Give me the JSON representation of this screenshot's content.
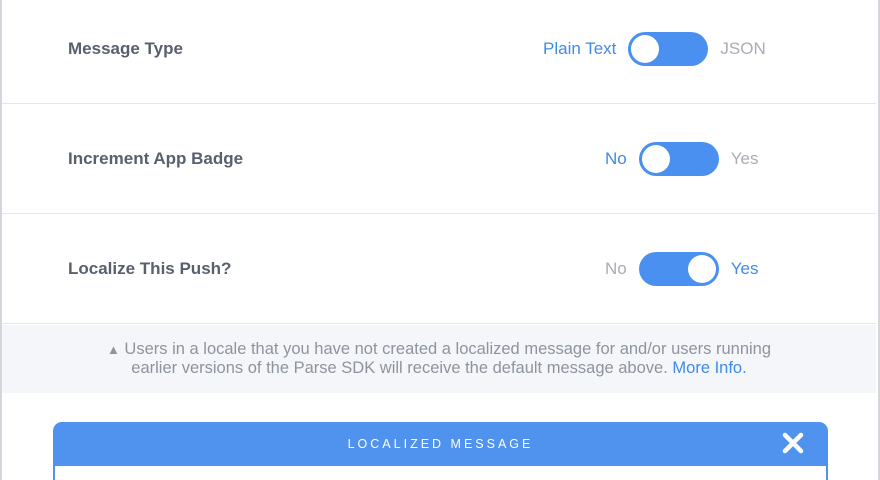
{
  "rows": [
    {
      "label": "Message Type",
      "left_option": "Plain Text",
      "right_option": "JSON",
      "selected": "Plain Text"
    },
    {
      "label": "Increment App Badge",
      "left_option": "No",
      "right_option": "Yes",
      "selected": "No"
    },
    {
      "label": "Localize This Push?",
      "left_option": "No",
      "right_option": "Yes",
      "selected": "Yes"
    }
  ],
  "notice": {
    "icon": "warning-icon",
    "line1": "Users in a locale that you have not created a localized message for and/or users running",
    "line2": "earlier versions of the Parse SDK will receive the default message above.",
    "link": "More Info."
  },
  "localized_panel": {
    "title": "LOCALIZED MESSAGE",
    "close_icon": "close-icon"
  },
  "colors": {
    "accent": "#4a90f0",
    "label": "#58606e",
    "muted": "#a8adb6"
  }
}
